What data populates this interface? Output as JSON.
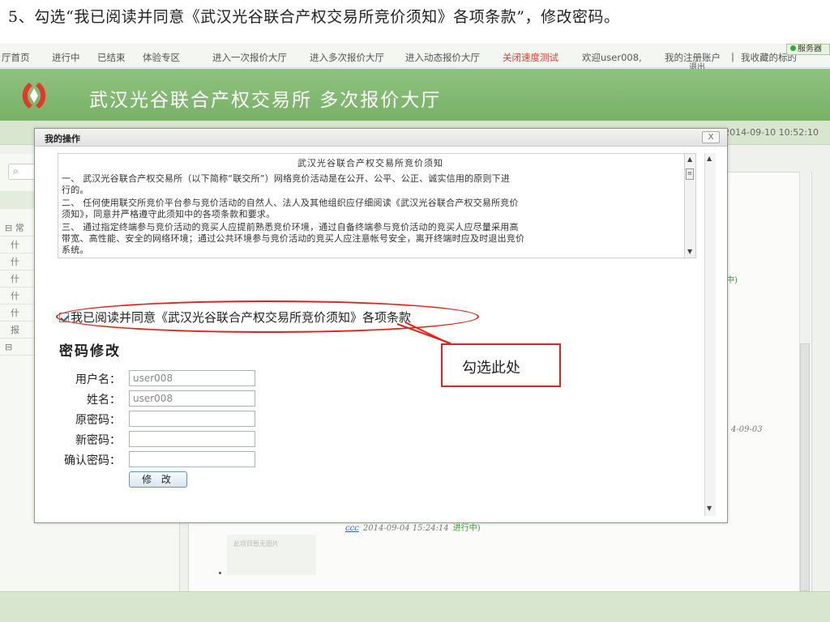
{
  "caption": "5、勾选“我已阅读并同意《武汉光谷联合产权交易所竞价须知》各项条款”，修改密码。",
  "topnav": {
    "items": [
      "厅首页",
      "进行中",
      "已结束",
      "体验专区",
      "进入一次报价大厅",
      "进入多次报价大厅",
      "进入动态报价大厅",
      "关闭速度测试"
    ],
    "welcome": "欢迎user008,",
    "my_account": "我的注册账户",
    "logout": "退出",
    "separator": "|",
    "favorites": "我收藏的标的",
    "service_badge": "服务器"
  },
  "banner": {
    "title": "武汉光谷联合产权交易所  多次报价大厅"
  },
  "clock": "2014-09-10 10:52:10",
  "left_panel": {
    "items": [
      "常",
      "什",
      "什",
      "什",
      "什",
      "什",
      "报",
      "⊟"
    ]
  },
  "background": {
    "fragment_mid": "中)",
    "date_fragment": "4-09-03",
    "placeholder_text": "此项目暂无图片",
    "link_text": "ccc",
    "timestamp": "2014-09-04 15:24:14",
    "status": "进行中)"
  },
  "dialog": {
    "title": "我的操作",
    "close_label": "X",
    "notice": {
      "title": "武汉光谷联合产权交易所竞价须知",
      "lines": [
        "一、 武汉光谷联合产权交易所（以下简称“联交所”）网络竞价活动是在公开、公平、公正、诚实信用的原则下进",
        "行的。",
        "二、 任何使用联交所竞价平台参与竞价活动的自然人、法人及其他组织应仔细阅读《武汉光谷联合产权交易所竞价",
        "须知》，同意并严格遵守此须知中的各项条款和要求。",
        "三、 通过指定终端参与竞价活动的竞买人应提前熟悉竞价环境，通过自备终端参与竞价活动的竞买人应尽量采用高",
        "带宽、高性能、安全的网络环境；通过公共环境参与竞价活动的竞买人应注意帐号安全，离开终端时应及时退出竞价",
        "系统。"
      ]
    },
    "agree_label": "我已阅读并同意《武汉光谷联合产权交易所竞价须知》各项条款",
    "agree_checked": true,
    "password_section": {
      "title": "密码修改",
      "fields": [
        {
          "label": "用户名：",
          "value": "user008"
        },
        {
          "label": "姓名：",
          "value": "user008"
        },
        {
          "label": "原密码：",
          "value": ""
        },
        {
          "label": "新密码：",
          "value": ""
        },
        {
          "label": "确认密码：",
          "value": ""
        }
      ],
      "submit_label": "修 改"
    }
  },
  "callout": {
    "text": "勾选此处"
  },
  "colors": {
    "annotation_red": "#e2231a",
    "banner_green": "#78b166",
    "nav_red": "#e03a2f"
  }
}
